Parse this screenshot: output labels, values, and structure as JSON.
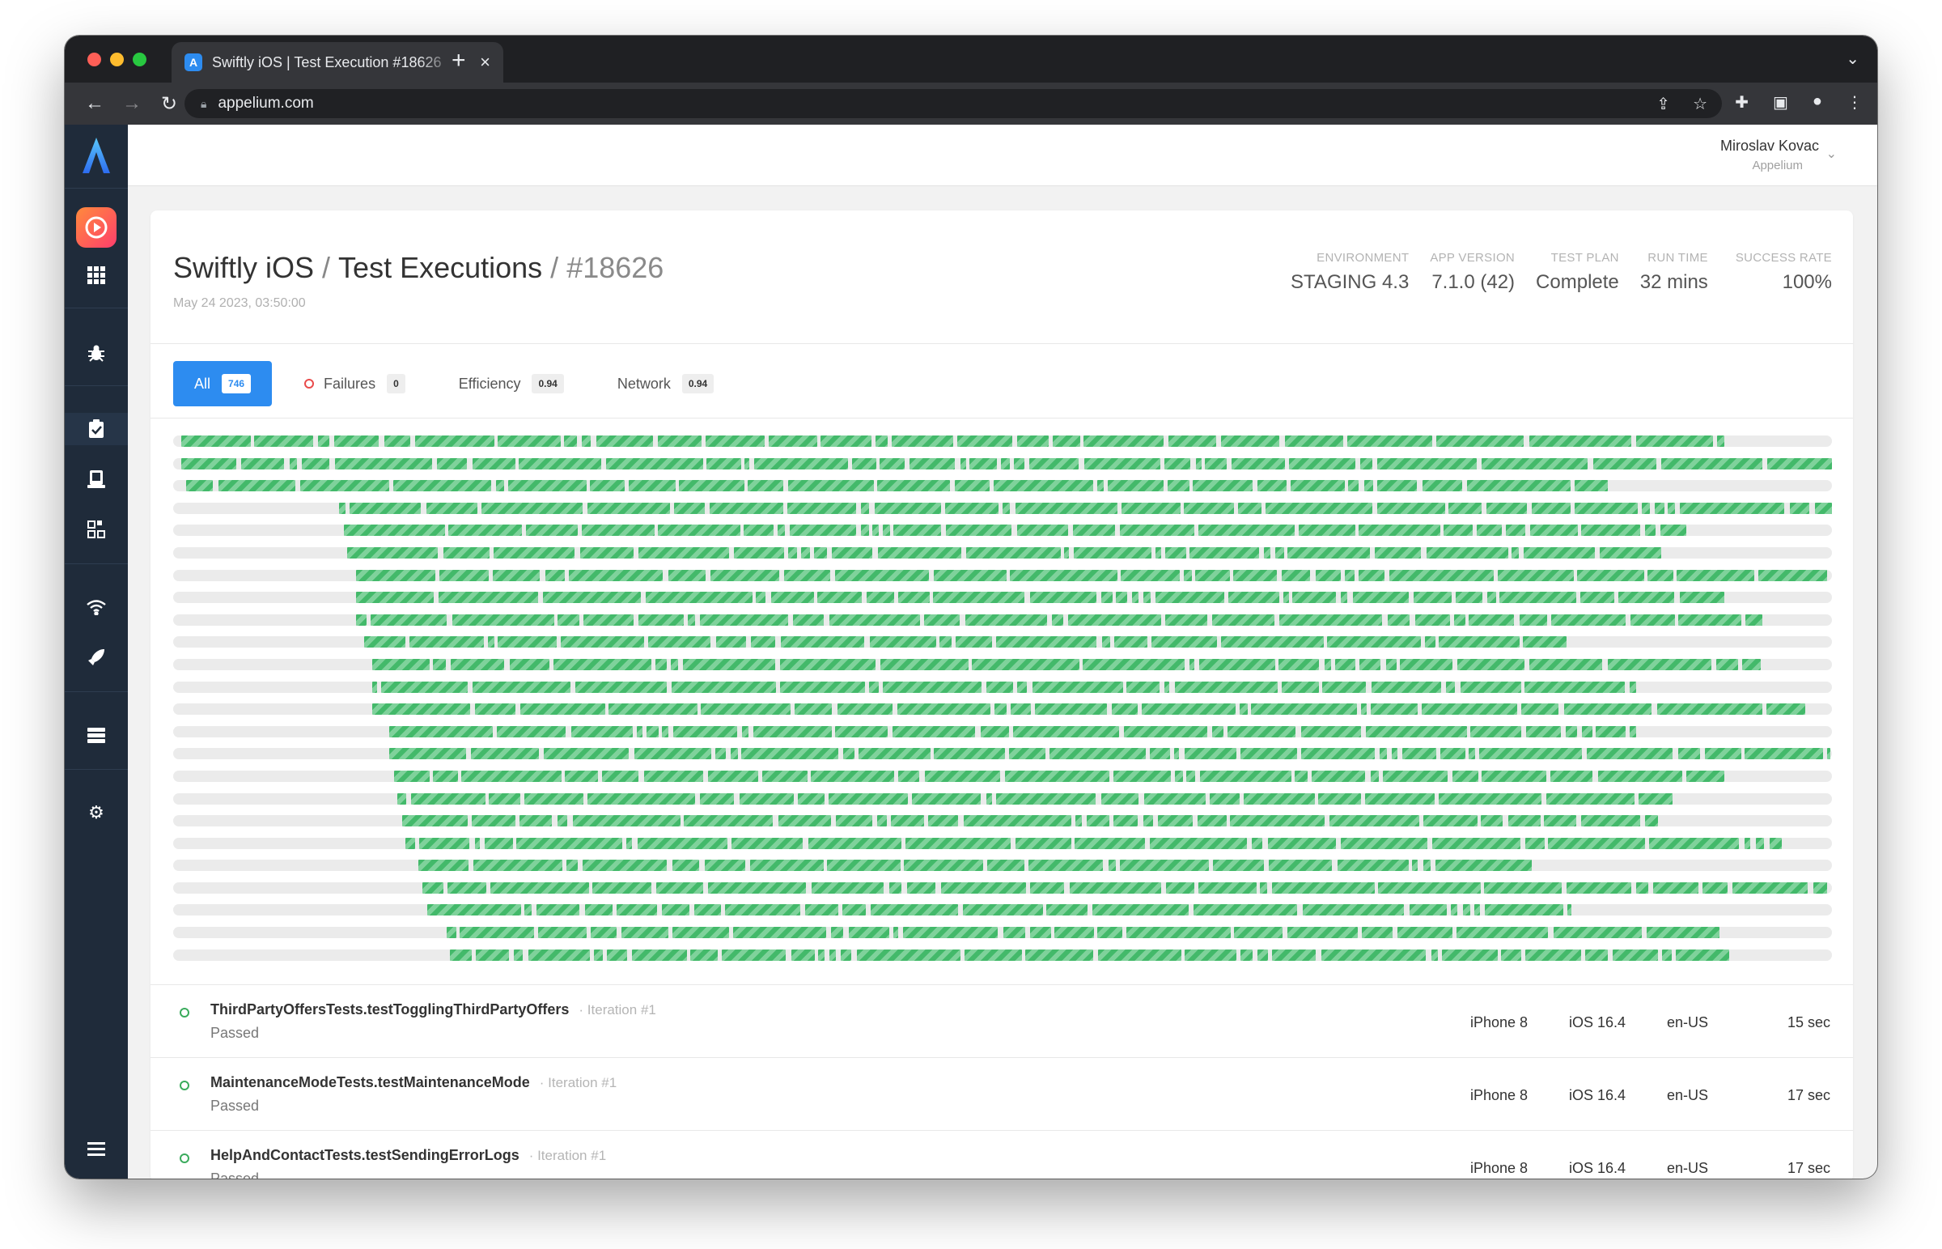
{
  "browser": {
    "tab_title": "Swiftly iOS | Test Execution #18626",
    "tab_favicon": "A",
    "url": "appelium.com"
  },
  "user": {
    "name": "Miroslav Kovac",
    "org": "Appelium"
  },
  "breadcrumb": {
    "project": "Swiftly iOS",
    "section": "Test Executions",
    "id": "#18626"
  },
  "date": "May 24 2023, 03:50:00",
  "stats": [
    {
      "label": "ENVIRONMENT",
      "value": "STAGING 4.3"
    },
    {
      "label": "APP VERSION",
      "value": "7.1.0 (42)"
    },
    {
      "label": "TEST PLAN",
      "value": "Complete"
    },
    {
      "label": "RUN TIME",
      "value": "32 mins"
    },
    {
      "label": "SUCCESS RATE",
      "value": "100%"
    }
  ],
  "filters": [
    {
      "label": "All",
      "count": "746",
      "active": true
    },
    {
      "label": "Failures",
      "count": "0",
      "active": false
    },
    {
      "label": "Efficiency",
      "count": "0.94",
      "active": false
    },
    {
      "label": "Network",
      "count": "0.94",
      "active": false
    }
  ],
  "timeline": {
    "status_color": "#43b96a",
    "rows": [
      {
        "start": 0.005,
        "end": 0.935
      },
      {
        "start": 0.005,
        "end": 1.0
      },
      {
        "start": 0.008,
        "end": 0.865
      },
      {
        "start": 0.1,
        "end": 1.0
      },
      {
        "start": 0.103,
        "end": 0.912
      },
      {
        "start": 0.105,
        "end": 0.897
      },
      {
        "start": 0.11,
        "end": 0.997
      },
      {
        "start": 0.11,
        "end": 0.935
      },
      {
        "start": 0.11,
        "end": 0.958
      },
      {
        "start": 0.115,
        "end": 0.84
      },
      {
        "start": 0.12,
        "end": 0.957
      },
      {
        "start": 0.12,
        "end": 0.882
      },
      {
        "start": 0.12,
        "end": 0.986
      },
      {
        "start": 0.13,
        "end": 0.882
      },
      {
        "start": 0.13,
        "end": 0.999
      },
      {
        "start": 0.133,
        "end": 0.935
      },
      {
        "start": 0.135,
        "end": 0.904
      },
      {
        "start": 0.138,
        "end": 0.895
      },
      {
        "start": 0.14,
        "end": 0.97
      },
      {
        "start": 0.148,
        "end": 0.819
      },
      {
        "start": 0.15,
        "end": 0.997
      },
      {
        "start": 0.153,
        "end": 0.843
      },
      {
        "start": 0.165,
        "end": 0.932
      },
      {
        "start": 0.167,
        "end": 0.94
      }
    ]
  },
  "results": [
    {
      "name": "ThirdPartyOffersTests.testTogglingThirdPartyOffers",
      "iteration": "· Iteration #1",
      "status": "Passed",
      "device": "iPhone 8",
      "os": "iOS 16.4",
      "locale": "en-US",
      "duration": "15 sec"
    },
    {
      "name": "MaintenanceModeTests.testMaintenanceMode",
      "iteration": "· Iteration #1",
      "status": "Passed",
      "device": "iPhone 8",
      "os": "iOS 16.4",
      "locale": "en-US",
      "duration": "17 sec"
    },
    {
      "name": "HelpAndContactTests.testSendingErrorLogs",
      "iteration": "· Iteration #1",
      "status": "Passed",
      "device": "iPhone 8",
      "os": "iOS 16.4",
      "locale": "en-US",
      "duration": "17 sec"
    }
  ],
  "sidebar": {
    "icons": [
      "appelium-logo",
      "app-icon",
      "grid-icon",
      "bug-icon",
      "clipboard-check-icon",
      "device-icon",
      "qr-icon",
      "wifi-icon",
      "rocket-icon",
      "database-icon",
      "gear-icon",
      "menu-icon"
    ]
  }
}
